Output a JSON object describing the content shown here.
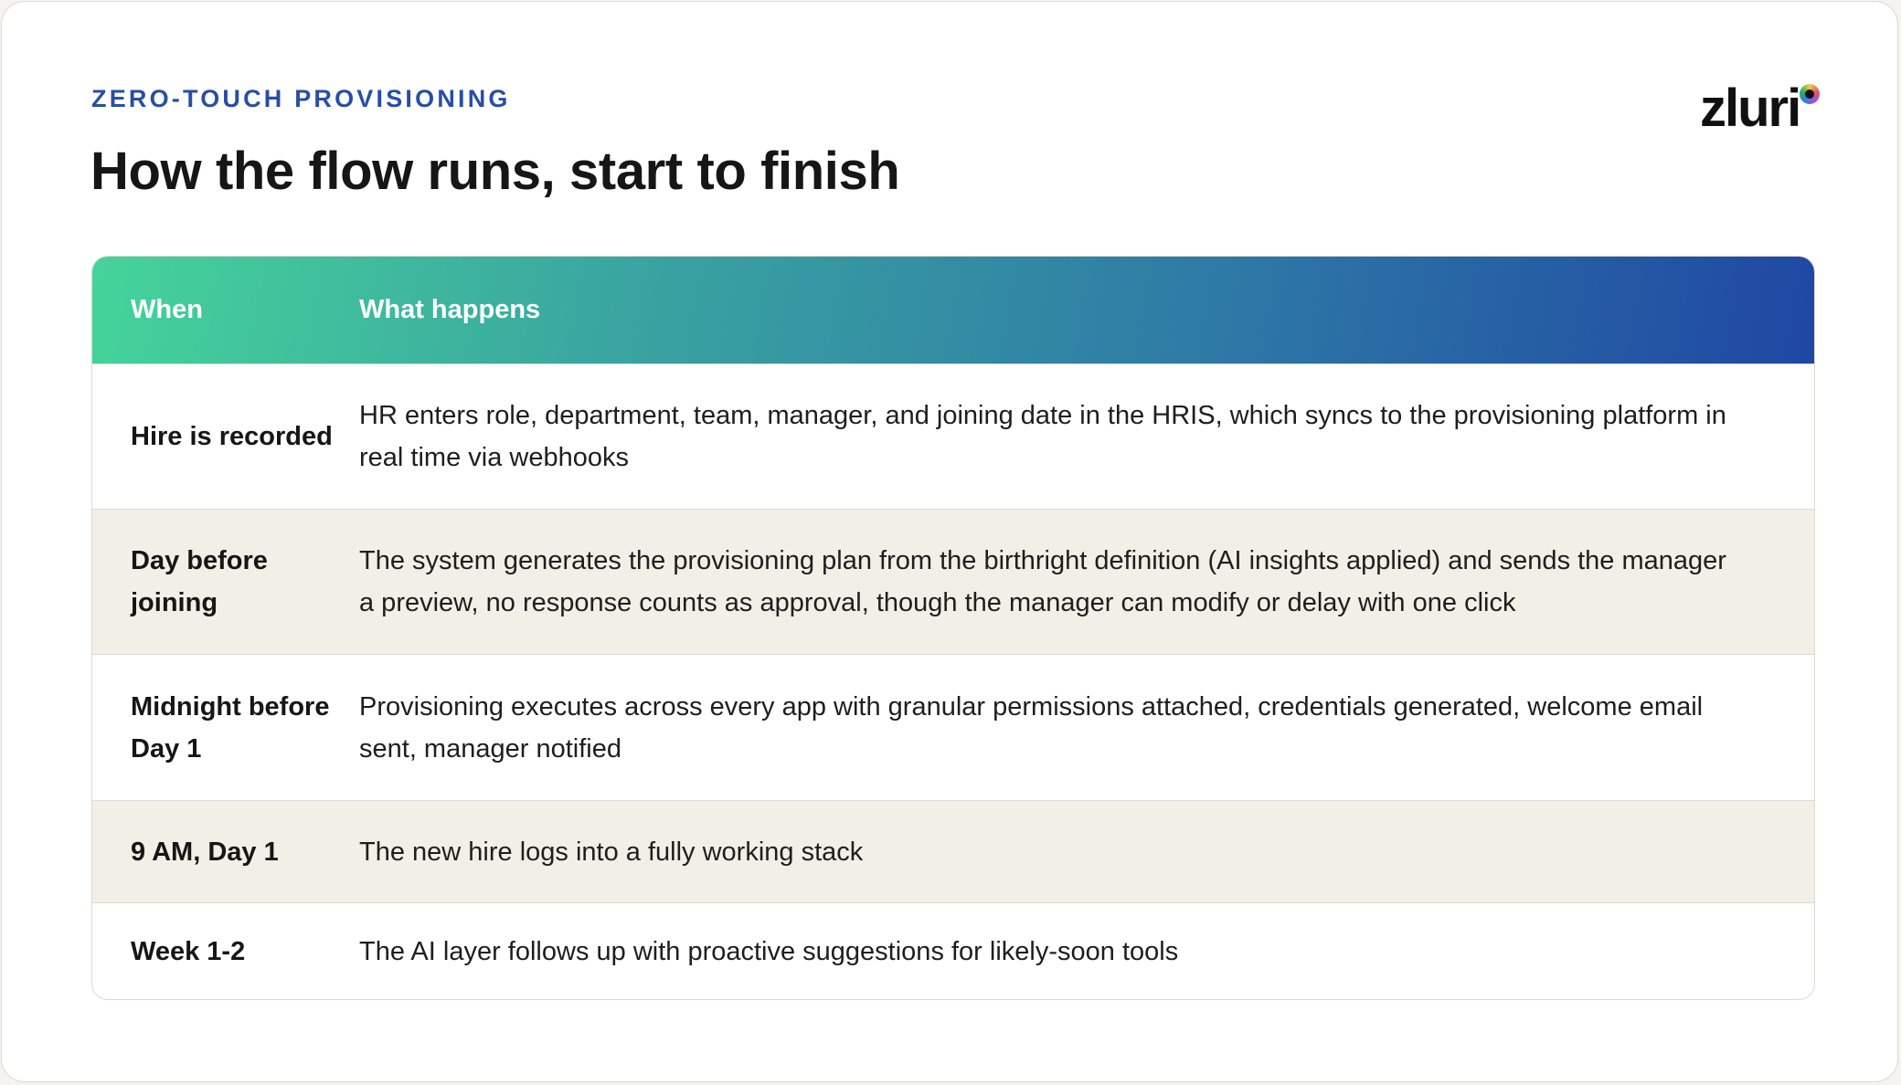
{
  "header": {
    "eyebrow": "ZERO-TOUCH PROVISIONING",
    "title": "How the flow runs, start to finish",
    "logo_text": "zluri"
  },
  "table": {
    "columns": [
      "When",
      "What happens"
    ],
    "rows": [
      {
        "when": "Hire is recorded",
        "what": "HR enters role, department, team, manager, and joining date in the HRIS, which syncs to the provisioning platform in real time via webhooks"
      },
      {
        "when": "Day before joining",
        "what": "The system generates the provisioning plan from the birthright definition (AI insights applied) and sends the manager a preview, no response counts as approval, though the manager can modify or delay with one click"
      },
      {
        "when": "Midnight before Day 1",
        "what": "Provisioning executes across every app with granular permissions attached, credentials generated, welcome email sent, manager notified"
      },
      {
        "when": "9 AM, Day 1",
        "what": "The new hire logs into a fully working stack"
      },
      {
        "when": "Week 1-2",
        "what": "The AI layer follows up with proactive suggestions for likely-soon tools"
      }
    ]
  },
  "colors": {
    "eyebrow": "#274fa3",
    "header_gradient_start": "#45d49a",
    "header_gradient_end": "#1f47a3",
    "alt_row": "#f2efe7"
  }
}
